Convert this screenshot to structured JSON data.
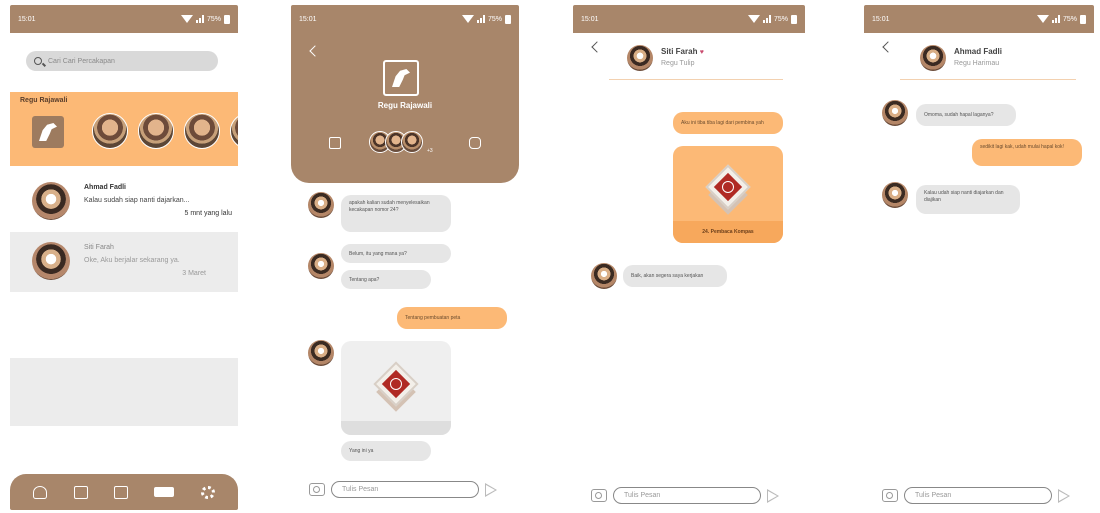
{
  "status": {
    "time": "15:01",
    "battery": "75%"
  },
  "screen1": {
    "search_placeholder": "Cari Cari Percakapan",
    "group_title": "Regu Rajawali",
    "chats": [
      {
        "name": "Ahmad Fadli",
        "message": "Kalau sudah siap nanti dajarkan...",
        "time": "5 mnt yang lalu"
      },
      {
        "name": "Siti Farah",
        "message": "Oke, Aku berjalar sekarang ya.",
        "time": "3 Maret"
      }
    ],
    "nav": [
      "award-icon",
      "document-icon",
      "image-icon",
      "chat-icon",
      "gear-icon"
    ]
  },
  "screen2": {
    "group_title": "Regu Rajawali",
    "member_more": "+3",
    "messages": [
      {
        "dir": "in",
        "text": "apakah kalian sudah menyelesaikan kecakapan nomor 24?"
      },
      {
        "dir": "in",
        "text": "Belum, itu yang mana ya?"
      },
      {
        "dir": "in",
        "text": "Tentang apa?"
      },
      {
        "dir": "out",
        "text": "Tentang pembuatan peta"
      },
      {
        "dir": "in",
        "text": "Yang ini ya"
      }
    ],
    "input_placeholder": "Tulis Pesan"
  },
  "screen3": {
    "name": "Siti Farah",
    "heart": "♥",
    "subtitle": "Regu Tulip",
    "out1": "Aku ini tiba tiba lagi dari pembina yah",
    "badge_label": "24. Pembaca Kompas",
    "in1": "Baik, akan segera saya kerjakan",
    "input_placeholder": "Tulis Pesan"
  },
  "screen4": {
    "name": "Ahmad Fadli",
    "subtitle": "Regu Harimau",
    "in1": "Omoma, sudah hapal laganya?",
    "out1": "sedikit lagi kak, udah mulai hapal kok!",
    "in2": "Kalau udah siap nanti diajarkan dan diajikan",
    "input_placeholder": "Tulis Pesan"
  },
  "colors": {
    "brown": "#a8866a",
    "orange": "#fcb976",
    "badge_red": "#b02a24",
    "gray": "#ececec"
  }
}
